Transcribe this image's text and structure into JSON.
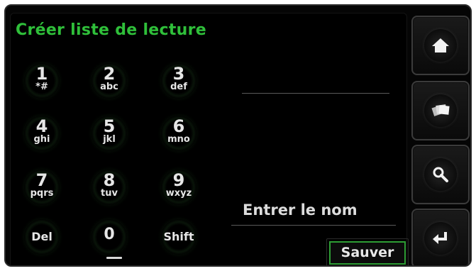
{
  "screen": {
    "title": "Créer liste de lecture",
    "accent_color": "#2fbf3a"
  },
  "keypad": {
    "keys": [
      {
        "num": "1",
        "letters": "*#"
      },
      {
        "num": "2",
        "letters": "abc"
      },
      {
        "num": "3",
        "letters": "def"
      },
      {
        "num": "4",
        "letters": "ghi"
      },
      {
        "num": "5",
        "letters": "jkl"
      },
      {
        "num": "6",
        "letters": "mno"
      },
      {
        "num": "7",
        "letters": "pqrs"
      },
      {
        "num": "8",
        "letters": "tuv"
      },
      {
        "num": "9",
        "letters": "wxyz"
      }
    ],
    "del_label": "Del",
    "zero_label": "0",
    "shift_label": "Shift"
  },
  "name_field": {
    "placeholder": "Entrer le nom"
  },
  "save_button": {
    "label": "Sauver"
  },
  "sidebar": {
    "buttons": [
      {
        "icon": "home-icon"
      },
      {
        "icon": "playlist-cards-icon"
      },
      {
        "icon": "search-icon"
      },
      {
        "icon": "enter-return-icon"
      }
    ]
  }
}
